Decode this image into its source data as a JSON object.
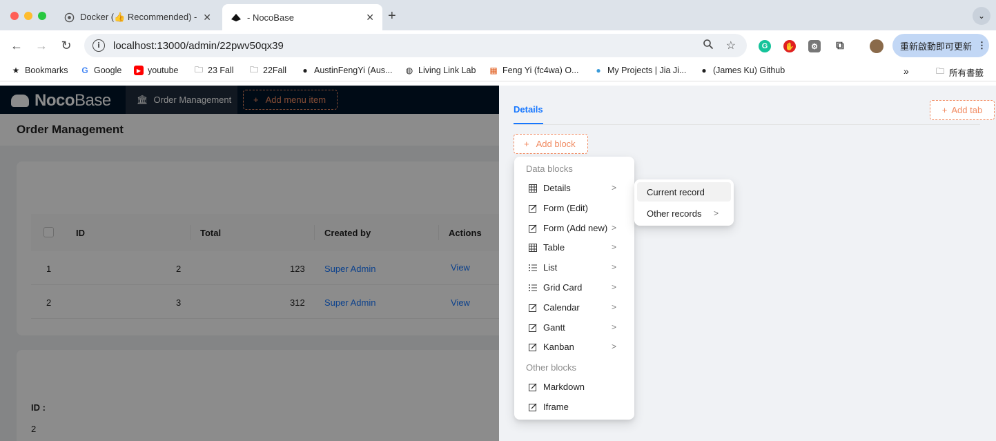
{
  "browser": {
    "tabs": [
      {
        "title": "Docker (👍 Recommended) -",
        "active": false
      },
      {
        "title": "- NocoBase",
        "active": true
      }
    ],
    "url": "localhost:13000/admin/22pwv50qx39",
    "update_button": "重新啟動即可更新",
    "bookmarks": [
      "Bookmarks",
      "Google",
      "youtube",
      "23 Fall",
      "22Fall",
      "AustinFengYi (Aus...",
      "Living Link Lab",
      "Feng Yi (fc4wa) O...",
      "My Projects | Jia Ji...",
      "(James Ku) Github"
    ],
    "all_bookmarks": "所有書籤"
  },
  "app": {
    "logo_noco": "Noco",
    "logo_base": "Base",
    "menu_item": "Order Management",
    "add_menu_item": "Add menu item",
    "page_title": "Order Management",
    "table": {
      "headers": [
        "ID",
        "Total",
        "Created by",
        "Actions"
      ],
      "rows": [
        {
          "index": "1",
          "id": "2",
          "total": "123",
          "created_by": "Super Admin",
          "action": "View"
        },
        {
          "index": "2",
          "id": "3",
          "total": "312",
          "created_by": "Super Admin",
          "action": "View"
        }
      ]
    },
    "detail": {
      "label": "ID :",
      "value": "2"
    }
  },
  "drawer": {
    "tab": "Details",
    "add_tab": "Add tab",
    "add_block": "Add block",
    "menu": {
      "data_blocks_title": "Data blocks",
      "data_blocks": [
        {
          "label": "Details",
          "icon": "table-icon",
          "has_submenu": true
        },
        {
          "label": "Form (Edit)",
          "icon": "edit-icon",
          "has_submenu": false
        },
        {
          "label": "Form (Add new)",
          "icon": "edit-icon",
          "has_submenu": true
        },
        {
          "label": "Table",
          "icon": "table-icon",
          "has_submenu": true
        },
        {
          "label": "List",
          "icon": "list-icon",
          "has_submenu": true
        },
        {
          "label": "Grid Card",
          "icon": "list-icon",
          "has_submenu": true
        },
        {
          "label": "Calendar",
          "icon": "edit-icon",
          "has_submenu": true
        },
        {
          "label": "Gantt",
          "icon": "edit-icon",
          "has_submenu": true
        },
        {
          "label": "Kanban",
          "icon": "edit-icon",
          "has_submenu": true
        }
      ],
      "other_blocks_title": "Other blocks",
      "other_blocks": [
        {
          "label": "Markdown",
          "icon": "edit-icon"
        },
        {
          "label": "Iframe",
          "icon": "edit-icon"
        }
      ]
    },
    "submenu": [
      {
        "label": "Current record",
        "has_submenu": false
      },
      {
        "label": "Other records",
        "has_submenu": true
      }
    ]
  },
  "colors": {
    "accent": "#1677ff",
    "dashed_button": "#f18b62",
    "header_bg": "#001529"
  }
}
